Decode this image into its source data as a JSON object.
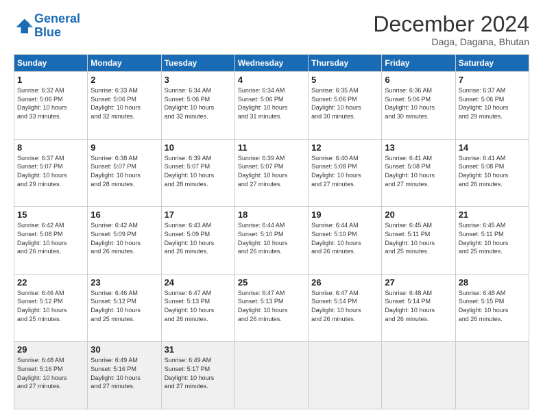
{
  "logo": {
    "line1": "General",
    "line2": "Blue"
  },
  "title": "December 2024",
  "subtitle": "Daga, Dagana, Bhutan",
  "days_header": [
    "Sunday",
    "Monday",
    "Tuesday",
    "Wednesday",
    "Thursday",
    "Friday",
    "Saturday"
  ],
  "weeks": [
    [
      {
        "day": "1",
        "text": "Sunrise: 6:32 AM\nSunset: 5:06 PM\nDaylight: 10 hours\nand 33 minutes."
      },
      {
        "day": "2",
        "text": "Sunrise: 6:33 AM\nSunset: 5:06 PM\nDaylight: 10 hours\nand 32 minutes."
      },
      {
        "day": "3",
        "text": "Sunrise: 6:34 AM\nSunset: 5:06 PM\nDaylight: 10 hours\nand 32 minutes."
      },
      {
        "day": "4",
        "text": "Sunrise: 6:34 AM\nSunset: 5:06 PM\nDaylight: 10 hours\nand 31 minutes."
      },
      {
        "day": "5",
        "text": "Sunrise: 6:35 AM\nSunset: 5:06 PM\nDaylight: 10 hours\nand 30 minutes."
      },
      {
        "day": "6",
        "text": "Sunrise: 6:36 AM\nSunset: 5:06 PM\nDaylight: 10 hours\nand 30 minutes."
      },
      {
        "day": "7",
        "text": "Sunrise: 6:37 AM\nSunset: 5:06 PM\nDaylight: 10 hours\nand 29 minutes."
      }
    ],
    [
      {
        "day": "8",
        "text": "Sunrise: 6:37 AM\nSunset: 5:07 PM\nDaylight: 10 hours\nand 29 minutes."
      },
      {
        "day": "9",
        "text": "Sunrise: 6:38 AM\nSunset: 5:07 PM\nDaylight: 10 hours\nand 28 minutes."
      },
      {
        "day": "10",
        "text": "Sunrise: 6:39 AM\nSunset: 5:07 PM\nDaylight: 10 hours\nand 28 minutes."
      },
      {
        "day": "11",
        "text": "Sunrise: 6:39 AM\nSunset: 5:07 PM\nDaylight: 10 hours\nand 27 minutes."
      },
      {
        "day": "12",
        "text": "Sunrise: 6:40 AM\nSunset: 5:08 PM\nDaylight: 10 hours\nand 27 minutes."
      },
      {
        "day": "13",
        "text": "Sunrise: 6:41 AM\nSunset: 5:08 PM\nDaylight: 10 hours\nand 27 minutes."
      },
      {
        "day": "14",
        "text": "Sunrise: 6:41 AM\nSunset: 5:08 PM\nDaylight: 10 hours\nand 26 minutes."
      }
    ],
    [
      {
        "day": "15",
        "text": "Sunrise: 6:42 AM\nSunset: 5:08 PM\nDaylight: 10 hours\nand 26 minutes."
      },
      {
        "day": "16",
        "text": "Sunrise: 6:42 AM\nSunset: 5:09 PM\nDaylight: 10 hours\nand 26 minutes."
      },
      {
        "day": "17",
        "text": "Sunrise: 6:43 AM\nSunset: 5:09 PM\nDaylight: 10 hours\nand 26 minutes."
      },
      {
        "day": "18",
        "text": "Sunrise: 6:44 AM\nSunset: 5:10 PM\nDaylight: 10 hours\nand 26 minutes."
      },
      {
        "day": "19",
        "text": "Sunrise: 6:44 AM\nSunset: 5:10 PM\nDaylight: 10 hours\nand 26 minutes."
      },
      {
        "day": "20",
        "text": "Sunrise: 6:45 AM\nSunset: 5:11 PM\nDaylight: 10 hours\nand 25 minutes."
      },
      {
        "day": "21",
        "text": "Sunrise: 6:45 AM\nSunset: 5:11 PM\nDaylight: 10 hours\nand 25 minutes."
      }
    ],
    [
      {
        "day": "22",
        "text": "Sunrise: 6:46 AM\nSunset: 5:12 PM\nDaylight: 10 hours\nand 25 minutes."
      },
      {
        "day": "23",
        "text": "Sunrise: 6:46 AM\nSunset: 5:12 PM\nDaylight: 10 hours\nand 25 minutes."
      },
      {
        "day": "24",
        "text": "Sunrise: 6:47 AM\nSunset: 5:13 PM\nDaylight: 10 hours\nand 26 minutes."
      },
      {
        "day": "25",
        "text": "Sunrise: 6:47 AM\nSunset: 5:13 PM\nDaylight: 10 hours\nand 26 minutes."
      },
      {
        "day": "26",
        "text": "Sunrise: 6:47 AM\nSunset: 5:14 PM\nDaylight: 10 hours\nand 26 minutes."
      },
      {
        "day": "27",
        "text": "Sunrise: 6:48 AM\nSunset: 5:14 PM\nDaylight: 10 hours\nand 26 minutes."
      },
      {
        "day": "28",
        "text": "Sunrise: 6:48 AM\nSunset: 5:15 PM\nDaylight: 10 hours\nand 26 minutes."
      }
    ],
    [
      {
        "day": "29",
        "text": "Sunrise: 6:48 AM\nSunset: 5:16 PM\nDaylight: 10 hours\nand 27 minutes."
      },
      {
        "day": "30",
        "text": "Sunrise: 6:49 AM\nSunset: 5:16 PM\nDaylight: 10 hours\nand 27 minutes."
      },
      {
        "day": "31",
        "text": "Sunrise: 6:49 AM\nSunset: 5:17 PM\nDaylight: 10 hours\nand 27 minutes."
      },
      {
        "day": "",
        "text": ""
      },
      {
        "day": "",
        "text": ""
      },
      {
        "day": "",
        "text": ""
      },
      {
        "day": "",
        "text": ""
      }
    ]
  ]
}
